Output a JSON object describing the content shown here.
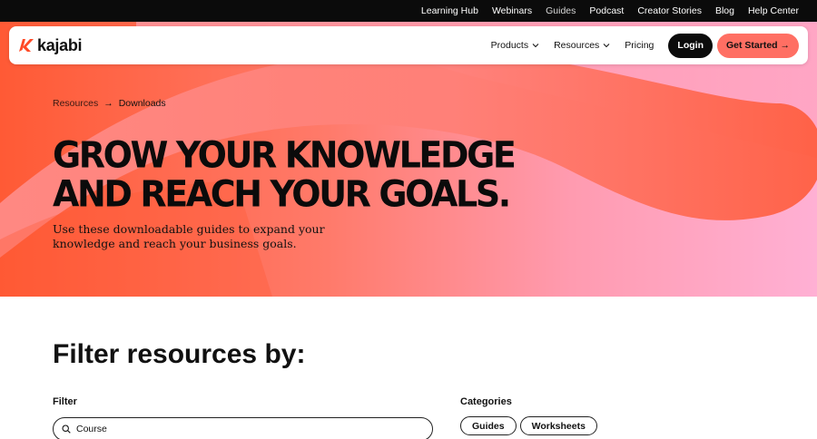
{
  "utility_nav": {
    "items": [
      {
        "label": "Learning Hub"
      },
      {
        "label": "Webinars"
      },
      {
        "label": "Guides"
      },
      {
        "label": "Podcast"
      },
      {
        "label": "Creator Stories"
      },
      {
        "label": "Blog"
      },
      {
        "label": "Help Center"
      }
    ],
    "active_index": 2
  },
  "header": {
    "logo_text": "kajabi",
    "nav": [
      {
        "label": "Products",
        "icon": "chevron-down-icon"
      },
      {
        "label": "Resources",
        "icon": "chevron-down-icon"
      },
      {
        "label": "Pricing"
      }
    ],
    "login_label": "Login",
    "get_started_label": "Get Started →"
  },
  "hero": {
    "breadcrumb": {
      "root": "Resources",
      "separator": "→",
      "current": "Downloads"
    },
    "title_line1": "GROW YOUR KNOWLEDGE",
    "title_line2": "AND REACH YOUR GOALS.",
    "subtitle": "Use these downloadable guides to expand your knowledge and reach your business goals."
  },
  "filter_section": {
    "heading": "Filter resources by:",
    "filter_label": "Filter",
    "search_value": "Course",
    "categories_label": "Categories",
    "categories": [
      {
        "label": "Guides"
      },
      {
        "label": "Worksheets"
      }
    ]
  },
  "colors": {
    "brand": "#ff5a35",
    "cta": "#ff6f63",
    "dark": "#0b0b0b",
    "hero_pink": "#ffb0d4"
  }
}
